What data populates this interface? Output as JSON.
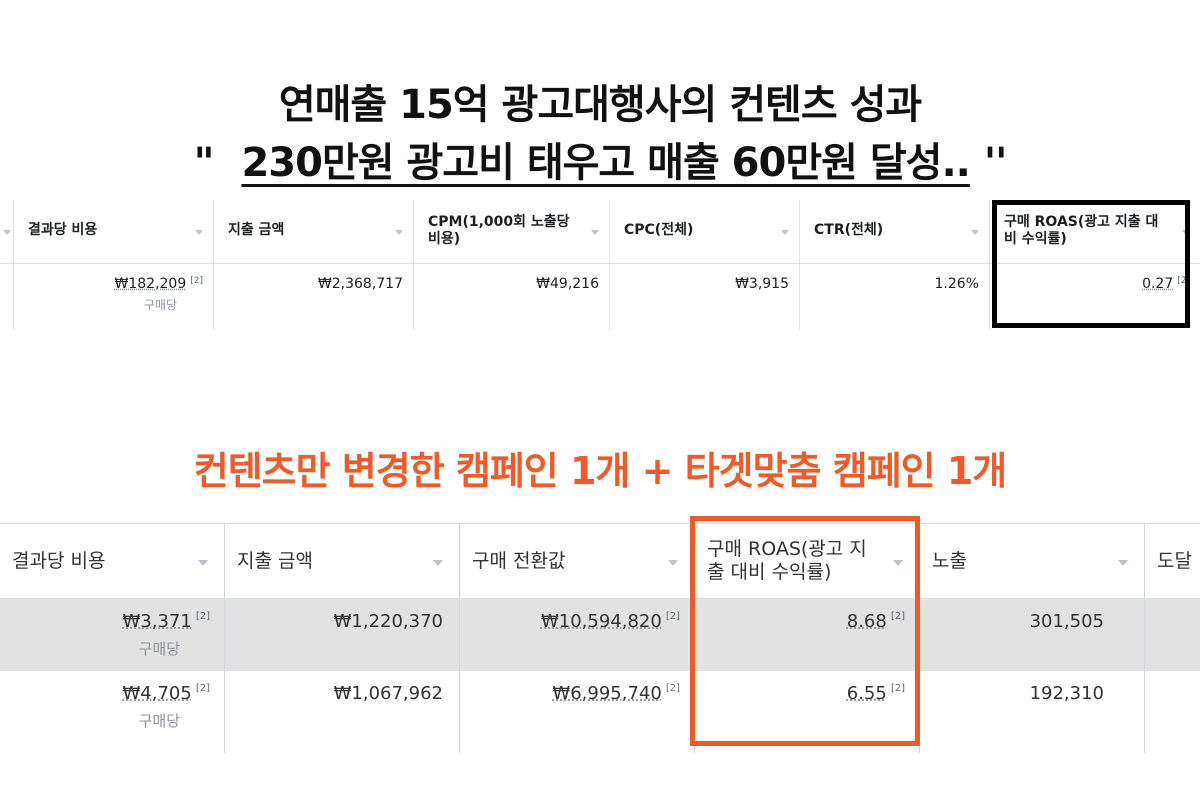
{
  "headline": {
    "line1": "연매출 15억 광고대행사의 컨텐츠 성과",
    "line2_open_quote": "\"",
    "line2_text": "230만원 광고비 태우고 매출 60만원 달성..",
    "line2_close_quote": "''"
  },
  "subheadline": "컨텐츠만 변경한 캠페인 1개 + 타겟맞춤 캠페인 1개",
  "colors": {
    "accent_orange": "#f05a28",
    "highlight_black": "#000000",
    "row_highlight": "#e2e2e2"
  },
  "table_before": {
    "columns": [
      "결과당 비용",
      "지출 금액",
      "CPM(1,000회 노출당 비용)",
      "CPC(전체)",
      "CTR(전체)",
      "구매 ROAS(광고 지출 대비 수익률)"
    ],
    "row": {
      "cost_per_result": "₩182,209",
      "cost_per_result_sub": "구매당",
      "spend": "₩2,368,717",
      "cpm": "₩49,216",
      "cpc": "₩3,915",
      "ctr": "1.26%",
      "roas": "0.27",
      "note_marker": "[2]"
    }
  },
  "table_after": {
    "columns": [
      "결과당 비용",
      "지출 금액",
      "구매 전환값",
      "구매 ROAS(광고 지출 대비 수익률)",
      "노출",
      "도달"
    ],
    "rows": [
      {
        "cost_per_result": "₩3,371",
        "cost_per_result_sub": "구매당",
        "spend": "₩1,220,370",
        "conversion_value": "₩10,594,820",
        "roas": "8.68",
        "impressions": "301,505"
      },
      {
        "cost_per_result": "₩4,705",
        "cost_per_result_sub": "구매당",
        "spend": "₩1,067,962",
        "conversion_value": "₩6,995,740",
        "roas": "6.55",
        "impressions": "192,310"
      }
    ],
    "note_marker": "[2]"
  }
}
